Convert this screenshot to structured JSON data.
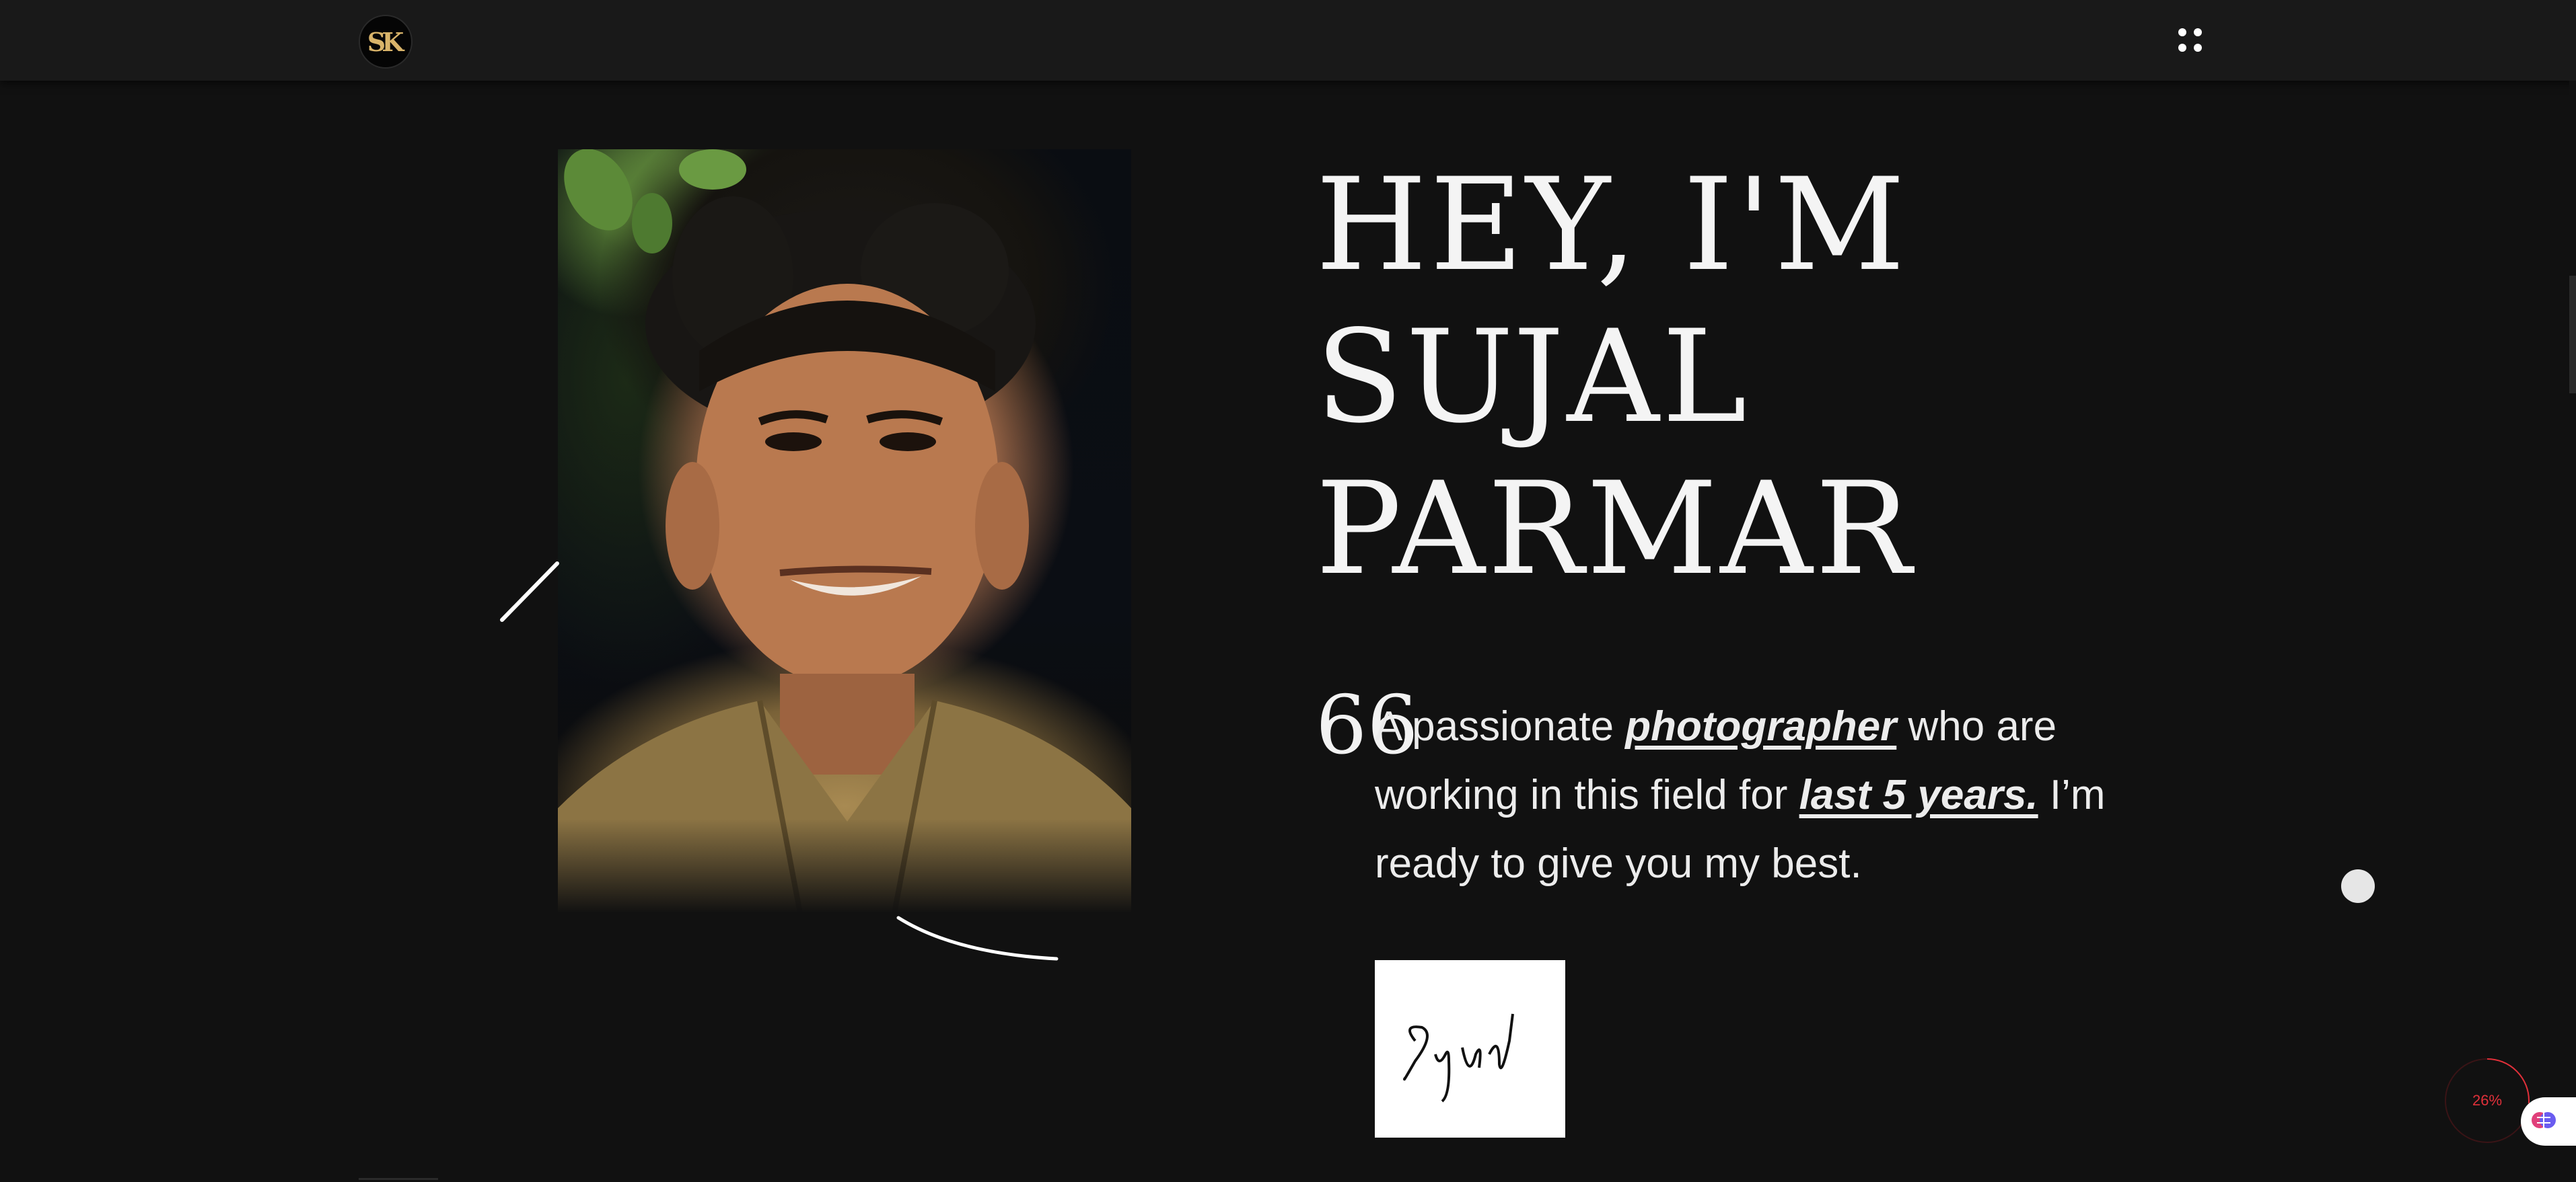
{
  "header": {
    "logo_text": "SK",
    "logo_color": "#d9b46a",
    "menu_icon": "dots-grid-icon"
  },
  "hero": {
    "title_lines": [
      "HEY, I'M",
      "SUJAL",
      "PARMAR"
    ],
    "quote_mark": "66",
    "intro": {
      "part1": "A passionate ",
      "highlight1": "photographer",
      "part2": " who are working in this field for ",
      "highlight2": "last 5 years.",
      "part3": " I’m ready to give you my best."
    },
    "signature": "Sujal"
  },
  "widgets": {
    "scroll_progress_text": "26%",
    "scroll_progress": 0.26,
    "progress_color": "#e0303a",
    "ai_button_icon": "brain-icon"
  }
}
